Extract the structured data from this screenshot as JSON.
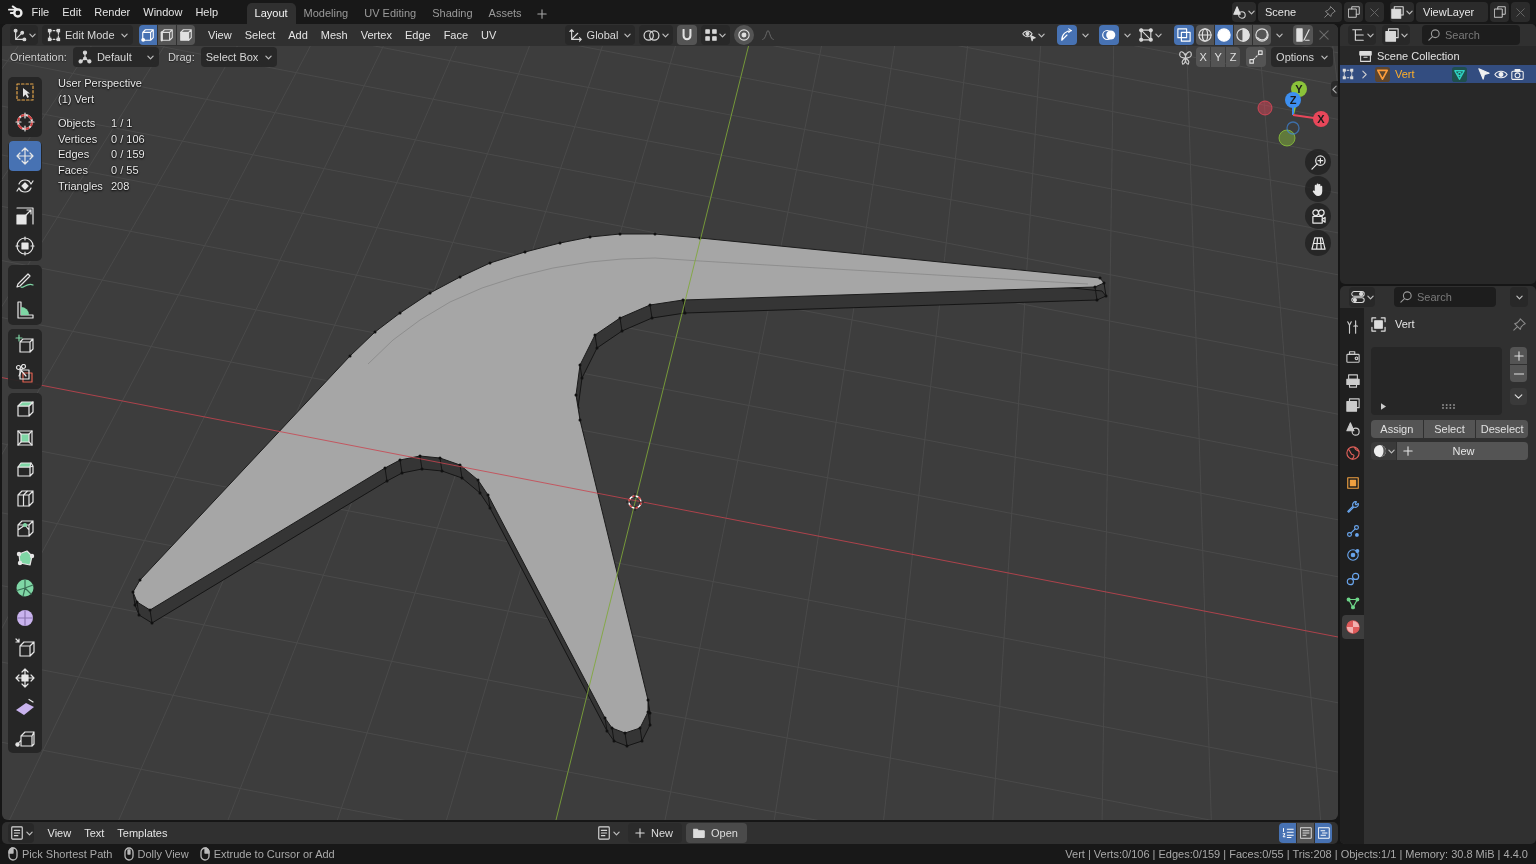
{
  "topbar": {
    "menus": [
      "File",
      "Edit",
      "Render",
      "Window",
      "Help"
    ],
    "workspaces": [
      {
        "label": "Layout",
        "selected": true
      },
      {
        "label": "Modeling",
        "selected": false
      },
      {
        "label": "UV Editing",
        "selected": false
      },
      {
        "label": "Shading",
        "selected": false
      },
      {
        "label": "Assets",
        "selected": false
      }
    ],
    "scene": "Scene",
    "view_layer": "ViewLayer"
  },
  "viewport": {
    "header": {
      "mode": "Edit Mode",
      "select_modes": [
        {
          "kind": "vertex",
          "selected": true
        },
        {
          "kind": "edge",
          "selected": false
        },
        {
          "kind": "face",
          "selected": false
        }
      ],
      "menus": [
        "View",
        "Select",
        "Add",
        "Mesh",
        "Vertex",
        "Edge",
        "Face",
        "UV"
      ],
      "orientation": "Global",
      "snapping": false,
      "proportional_editing": false,
      "gizmos": true,
      "overlays": true,
      "xray": true,
      "shading": [
        {
          "kind": "wireframe",
          "selected": false
        },
        {
          "kind": "solid",
          "selected": true
        },
        {
          "kind": "material",
          "selected": false
        },
        {
          "kind": "rendered",
          "selected": false
        }
      ]
    },
    "tool_settings": {
      "orientation_label": "Orientation:",
      "orientation": "Default",
      "drag_label": "Drag:",
      "drag": "Select Box",
      "mirror_axes": [
        {
          "label": "X",
          "on": false
        },
        {
          "label": "Y",
          "on": false
        },
        {
          "label": "Z",
          "on": false
        }
      ],
      "options": "Options"
    },
    "info": {
      "view": "User Perspective",
      "object": "(1) Vert",
      "stats": [
        {
          "label": "Objects",
          "value": "1 / 1"
        },
        {
          "label": "Vertices",
          "value": "0 / 106"
        },
        {
          "label": "Edges",
          "value": "0 / 159"
        },
        {
          "label": "Faces",
          "value": "0 / 55"
        },
        {
          "label": "Triangles",
          "value": "208"
        }
      ]
    },
    "toolbar": [
      {
        "tools": [
          {
            "kind": "select_box",
            "selected": false
          },
          {
            "kind": "cursor",
            "selected": false
          }
        ]
      },
      {
        "tools": [
          {
            "kind": "move",
            "selected": true
          },
          {
            "kind": "rotate",
            "selected": false
          },
          {
            "kind": "scale",
            "selected": false
          },
          {
            "kind": "transform",
            "selected": false
          }
        ]
      },
      {
        "tools": [
          {
            "kind": "annotate",
            "selected": false
          },
          {
            "kind": "measure",
            "selected": false
          }
        ]
      },
      {
        "tools": [
          {
            "kind": "add_cube",
            "selected": false
          },
          {
            "kind": "cut_cube",
            "selected": false
          }
        ]
      },
      {
        "tools": [
          {
            "kind": "extrude",
            "selected": false
          },
          {
            "kind": "inset",
            "selected": false
          },
          {
            "kind": "bevel",
            "selected": false
          },
          {
            "kind": "loop_cut",
            "selected": false
          },
          {
            "kind": "knife",
            "selected": false
          },
          {
            "kind": "poly_build",
            "selected": false
          },
          {
            "kind": "spin",
            "selected": false
          },
          {
            "kind": "smooth",
            "selected": false
          },
          {
            "kind": "edge_slide",
            "selected": false
          },
          {
            "kind": "shrink",
            "selected": false
          },
          {
            "kind": "shear",
            "selected": false
          },
          {
            "kind": "rip",
            "selected": false
          }
        ]
      }
    ],
    "gizmo_axes": [
      {
        "label": "X",
        "color": "#e8475a"
      },
      {
        "label": "Y",
        "color": "#8bc33a"
      },
      {
        "label": "Z",
        "color": "#3d8ff0"
      }
    ]
  },
  "outliner": {
    "search_placeholder": "Search",
    "items": [
      {
        "label": "Scene Collection",
        "children": [
          {
            "label": "Vert",
            "selected": true,
            "expanded": false
          }
        ]
      }
    ]
  },
  "properties": {
    "search_placeholder": "Search",
    "tabs": [
      {
        "kind": "tool",
        "selected": false
      },
      {
        "kind": "render",
        "selected": false
      },
      {
        "kind": "output",
        "selected": false
      },
      {
        "kind": "view_layer",
        "selected": false
      },
      {
        "kind": "scene",
        "selected": false
      },
      {
        "kind": "world",
        "selected": false
      },
      {
        "kind": "object",
        "selected": false
      },
      {
        "kind": "modifiers",
        "selected": false
      },
      {
        "kind": "particles",
        "selected": false
      },
      {
        "kind": "physics",
        "selected": false
      },
      {
        "kind": "constraints",
        "selected": false
      },
      {
        "kind": "data",
        "selected": false
      },
      {
        "kind": "material",
        "selected": true
      }
    ],
    "object_name": "Vert",
    "slot_buttons": [
      "Assign",
      "Select",
      "Deselect"
    ],
    "new_label": "New"
  },
  "text_editor": {
    "menus": [
      "View",
      "Text",
      "Templates"
    ],
    "new_label": "New",
    "open_label": "Open",
    "toggles": [
      {
        "kind": "line_numbers",
        "selected": true
      },
      {
        "kind": "word_wrap",
        "selected": false
      },
      {
        "kind": "syntax",
        "selected": true
      }
    ]
  },
  "status_bar": {
    "hints": [
      {
        "kind": "mouse_left",
        "label": "Pick Shortest Path"
      },
      {
        "kind": "mouse_middle",
        "label": "Dolly View"
      },
      {
        "kind": "mouse_right",
        "label": "Extrude to Cursor or Add"
      }
    ],
    "stats": "Vert | Verts:0/106 | Edges:0/159 | Faces:0/55 | Tris:208 | Objects:1/1 | Memory: 30.8 MiB | 4.4.0"
  }
}
